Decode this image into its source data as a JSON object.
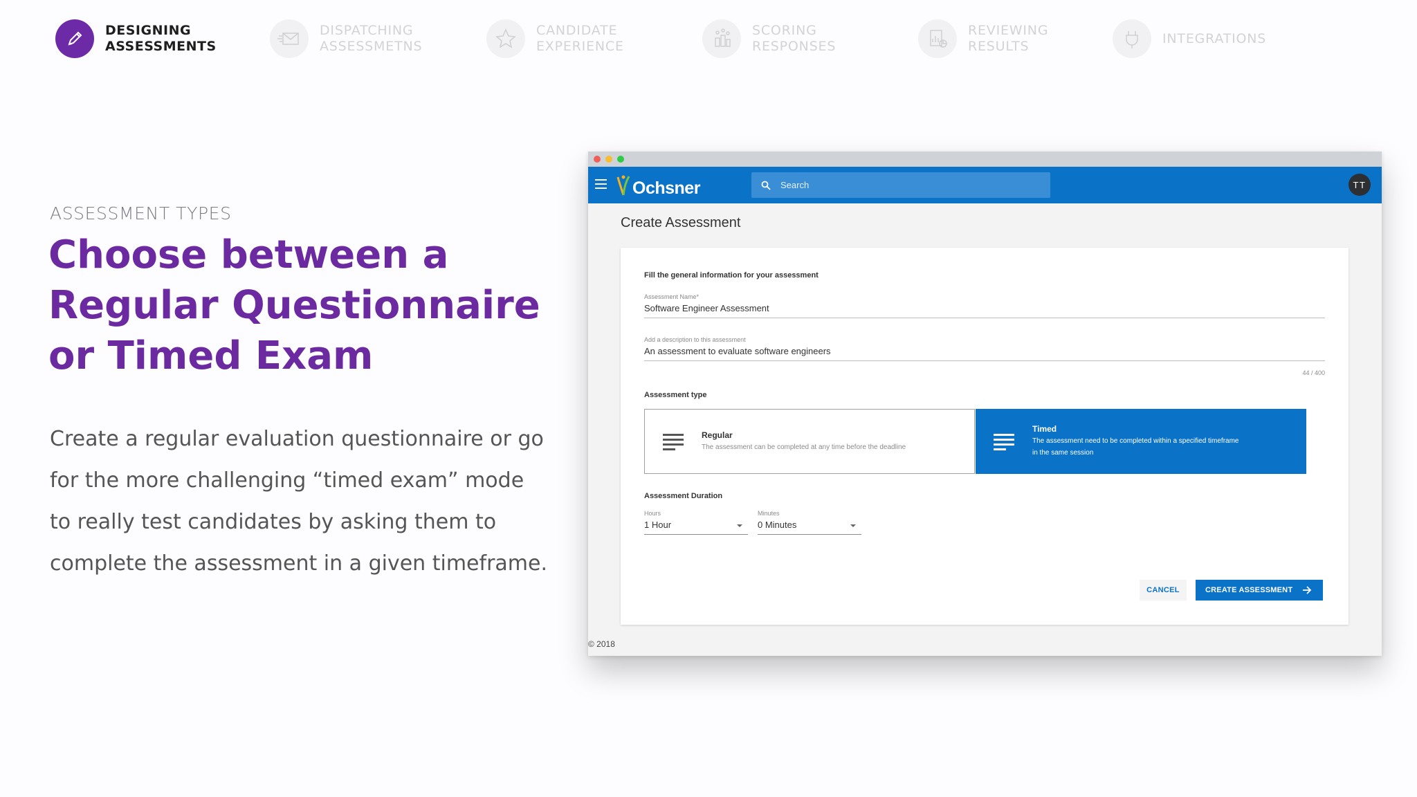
{
  "colors": {
    "brand_purple": "#6d2aa7",
    "headline_purple": "#6b2aa0",
    "app_blue": "#0a72c7",
    "window_dots": [
      "#ee5f57",
      "#f5bd2f",
      "#2ecb48"
    ]
  },
  "steps": [
    {
      "label": "DESIGNING\nASSESSMENTS",
      "icon": "pencil-icon",
      "active": true
    },
    {
      "label": "DISPATCHING\nASSESSMETNS",
      "icon": "envelope-icon",
      "active": false
    },
    {
      "label": "CANDIDATE\nEXPERIENCE",
      "icon": "star-icon",
      "active": false
    },
    {
      "label": "SCORING\nRESPONSES",
      "icon": "scoring-icon",
      "active": false
    },
    {
      "label": "REVIEWING\nRESULTS",
      "icon": "report-icon",
      "active": false
    },
    {
      "label": "INTEGRATIONS",
      "icon": "plug-icon",
      "active": false
    }
  ],
  "hero": {
    "eyebrow": "ASSESSMENT TYPES",
    "headline": "Choose between a Regular Questionnaire or Timed Exam",
    "body": "Create a regular evaluation questionnaire or go for the more challenging “timed exam” mode to really test candidates by asking them to complete the assessment in a given timeframe."
  },
  "app": {
    "brand": "Ochsner",
    "search_placeholder": "Search",
    "avatar_initials": "TT",
    "page_title": "Create Assessment",
    "form": {
      "intro": "Fill the general information for your assessment",
      "name_label": "Assessment Name*",
      "name_value": "Software Engineer Assessment",
      "desc_label": "Add a description to this assessment",
      "desc_value": "An assessment to evaluate software engineers",
      "desc_counter": "44 / 400",
      "type_heading": "Assessment type",
      "types": [
        {
          "title": "Regular",
          "desc": "The assessment can be completed at any time before the deadline",
          "selected": false
        },
        {
          "title": "Timed",
          "desc": "The assessment need to be completed within a specified timeframe in the same session",
          "selected": true
        }
      ],
      "duration_heading": "Assessment Duration",
      "hours_label": "Hours",
      "hours_value": "1 Hour",
      "minutes_label": "Minutes",
      "minutes_value": "0 Minutes",
      "cancel_label": "CANCEL",
      "create_label": "CREATE ASSESSMENT"
    },
    "footer": "© 2018"
  }
}
